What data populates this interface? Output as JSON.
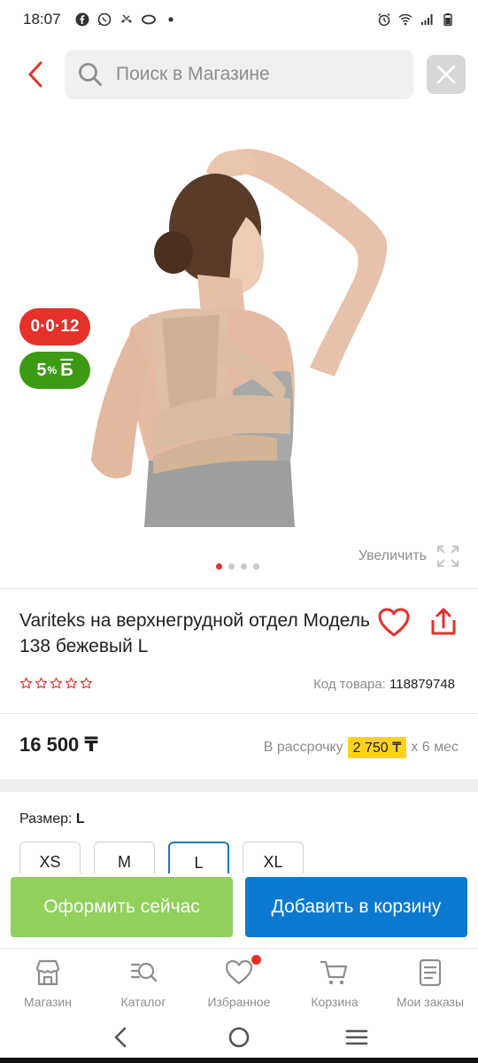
{
  "status_bar": {
    "time": "18:07"
  },
  "search": {
    "placeholder": "Поиск в Магазине"
  },
  "product": {
    "badge_installment": "0·0·12",
    "badge_bonus_value": "5",
    "badge_bonus_percent": "%",
    "badge_bonus_currency": "Б",
    "zoom_label": "Увеличить",
    "gallery_total": 4,
    "gallery_current": 1,
    "title": "Variteks на верхнегрудной отдел Модель 138 бежевый L",
    "rating_stars_filled": 0,
    "rating_stars_total": 5,
    "code_label": "Код товара:",
    "code_value": "118879748",
    "price": "16 500 ₸",
    "installment_label": "В рассрочку",
    "installment_amount": "2 750 ₸",
    "installment_term": "х 6 мес",
    "size_label": "Размер:",
    "size_selected": "L",
    "sizes": [
      "XS",
      "M",
      "L",
      "XL"
    ]
  },
  "actions": {
    "buy_now": "Оформить сейчас",
    "add_to_cart": "Добавить в корзину"
  },
  "bottom_nav": {
    "items": [
      {
        "label": "Магазин",
        "icon": "store-icon"
      },
      {
        "label": "Каталог",
        "icon": "catalog-icon"
      },
      {
        "label": "Избранное",
        "icon": "heart-icon"
      },
      {
        "label": "Корзина",
        "icon": "cart-icon"
      },
      {
        "label": "Мои заказы",
        "icon": "orders-icon"
      }
    ]
  },
  "colors": {
    "accent_red": "#e4312a",
    "bonus_green": "#3d9a15",
    "buy_green": "#8fd15c",
    "cart_blue": "#0b79d0",
    "installment_yellow": "#ffd21f",
    "selected_border": "#1e73be"
  }
}
